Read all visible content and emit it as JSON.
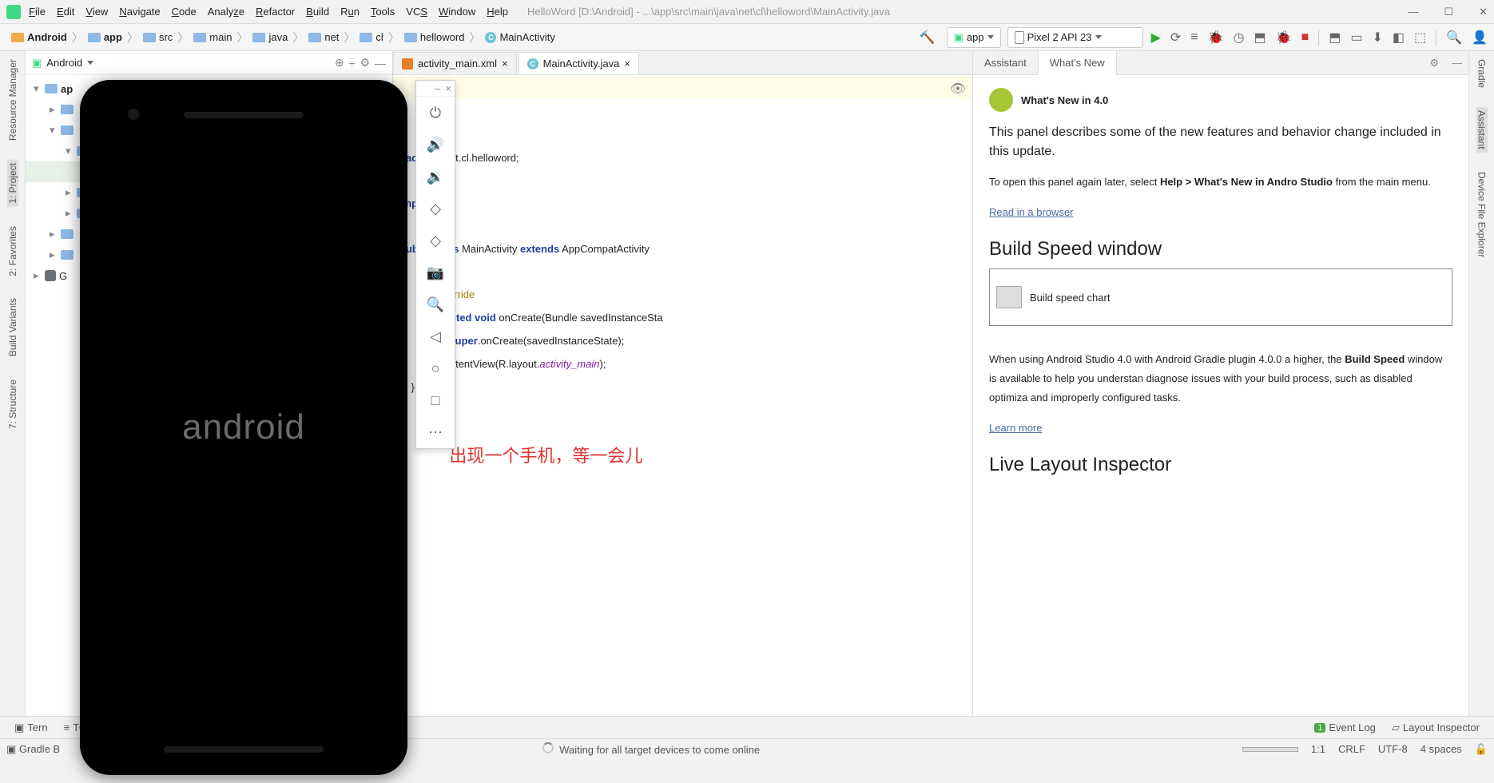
{
  "title_path": "HelloWord [D:\\Android] - ...\\app\\src\\main\\java\\net\\cl\\helloword\\MainActivity.java",
  "menu": [
    "File",
    "Edit",
    "View",
    "Navigate",
    "Code",
    "Analyze",
    "Refactor",
    "Build",
    "Run",
    "Tools",
    "VCS",
    "Window",
    "Help"
  ],
  "breadcrumbs": [
    "Android",
    "app",
    "src",
    "main",
    "java",
    "net",
    "cl",
    "helloword",
    "MainActivity"
  ],
  "run_config": "app",
  "device_combo": "Pixel 2 API 23",
  "project_view": "Android",
  "tree": {
    "app_label": "ap",
    "gradle_label": "G"
  },
  "tabs": {
    "xml": "activity_main.xml",
    "java": "MainActivity.java"
  },
  "code": {
    "line1a": "package",
    "line1b": " net.cl.helloword;",
    "line2a": "import",
    "line2b": " ...",
    "line3a": "public class",
    "line3b": " MainActivity ",
    "line3c": "extends",
    "line3d": " AppCompatActivity",
    "line4": "@Override",
    "line5a": "protected void",
    "line5b": " onCreate(Bundle savedInstanceSta",
    "line6a": "super",
    "line6b": ".onCreate(savedInstanceState);",
    "line7a": "        setContentView(R.layout.",
    "line7b": "activity_main",
    "line7c": ");",
    "line8": "    }",
    "line9": "}",
    "note": "出现一个手机，等一会儿"
  },
  "emulator_boot": "android",
  "whats_tabs": {
    "assistant": "Assistant",
    "new": "What's New"
  },
  "whats": {
    "h1": "What's New in 4.0",
    "p1": "This panel describes some of the new features and behavior change included in this update.",
    "p2a": "To open this panel again later, select ",
    "p2b": "Help > What's New in Andro Studio",
    "p2c": " from the main menu.",
    "link1": "Read in a browser",
    "h2": "Build Speed window",
    "chart_label": "Build speed chart",
    "p3a": "When using Android Studio 4.0 with Android Gradle plugin 4.0.0 a higher, the ",
    "p3b": "Build Speed",
    "p3c": " window is available to help you understan diagnose issues with your build process, such as disabled optimiza and improperly configured tasks.",
    "link2": "Learn more",
    "h3": "Live Layout Inspector"
  },
  "status1": {
    "terminal": "Tern",
    "todo": "TODO",
    "gradle": "Gradle B",
    "event": "Event Log",
    "layout": "Layout Inspector",
    "event_count": "1"
  },
  "status2": {
    "msg": "Waiting for all target devices to come online",
    "pos": "1:1",
    "eol": "CRLF",
    "enc": "UTF-8",
    "indent": "4 spaces"
  },
  "rails": {
    "rm": "Resource Manager",
    "proj": "1: Project",
    "fav": "2: Favorites",
    "bv": "Build Variants",
    "struct": "7: Structure",
    "gradle": "Gradle",
    "assistant": "Assistant",
    "dfe": "Device File Explorer"
  }
}
